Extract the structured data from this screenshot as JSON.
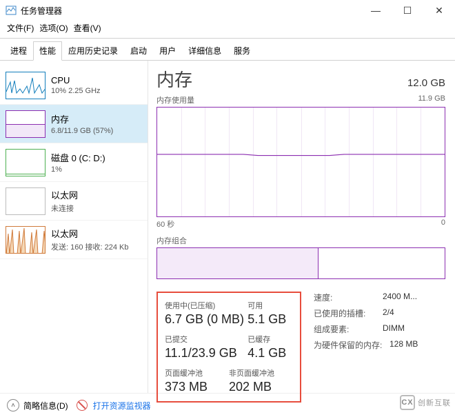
{
  "window": {
    "title": "任务管理器",
    "minimize": "—",
    "maximize": "☐",
    "close": "✕"
  },
  "menu": {
    "file": "文件(F)",
    "options": "选项(O)",
    "view": "查看(V)"
  },
  "tabs": {
    "t0": "进程",
    "t1": "性能",
    "t2": "应用历史记录",
    "t3": "启动",
    "t4": "用户",
    "t5": "详细信息",
    "t6": "服务"
  },
  "sidebar": {
    "cpu": {
      "title": "CPU",
      "sub": "10%  2.25 GHz"
    },
    "mem": {
      "title": "内存",
      "sub": "6.8/11.9 GB (57%)"
    },
    "disk": {
      "title": "磁盘 0 (C: D:)",
      "sub": "1%"
    },
    "eth0": {
      "title": "以太网",
      "sub": "未连接"
    },
    "eth1": {
      "title": "以太网",
      "sub": "发送: 160  接收: 224 Kb"
    }
  },
  "content": {
    "heading": "内存",
    "capacity": "12.0 GB",
    "chart_top_left": "内存使用量",
    "chart_top_right": "11.9 GB",
    "axis_left": "60 秒",
    "axis_right": "0",
    "comp_label": "内存组合"
  },
  "stats": {
    "in_use_label": "使用中(已压缩)",
    "in_use_val": "6.7 GB (0 MB)",
    "avail_label": "可用",
    "avail_val": "5.1 GB",
    "commit_label": "已提交",
    "commit_val": "11.1/23.9 GB",
    "cached_label": "已缓存",
    "cached_val": "4.1 GB",
    "paged_label": "页面缓冲池",
    "paged_val": "373 MB",
    "nonpaged_label": "非页面缓冲池",
    "nonpaged_val": "202 MB"
  },
  "specs": {
    "speed_k": "速度:",
    "speed_v": "2400 M...",
    "slots_k": "已使用的插槽:",
    "slots_v": "2/4",
    "form_k": "组成要素:",
    "form_v": "DIMM",
    "hw_k": "为硬件保留的内存:",
    "hw_v": "128 MB"
  },
  "footer": {
    "fewer": "简略信息(D)",
    "resmon": "打开资源监视器"
  },
  "watermark": {
    "logo": "CX",
    "text": "创新互联"
  },
  "chart_data": {
    "type": "line",
    "title": "内存使用量",
    "ylabel": "GB",
    "ylim": [
      0,
      11.9
    ],
    "x": [
      "60 秒",
      "0"
    ],
    "series": [
      {
        "name": "内存使用量",
        "values": [
          6.8,
          6.8,
          6.8,
          6.8,
          6.7,
          6.7,
          6.7,
          6.7,
          6.7,
          6.7,
          6.8,
          6.8,
          6.8
        ]
      }
    ],
    "composition": {
      "used_fraction": 0.56
    }
  }
}
